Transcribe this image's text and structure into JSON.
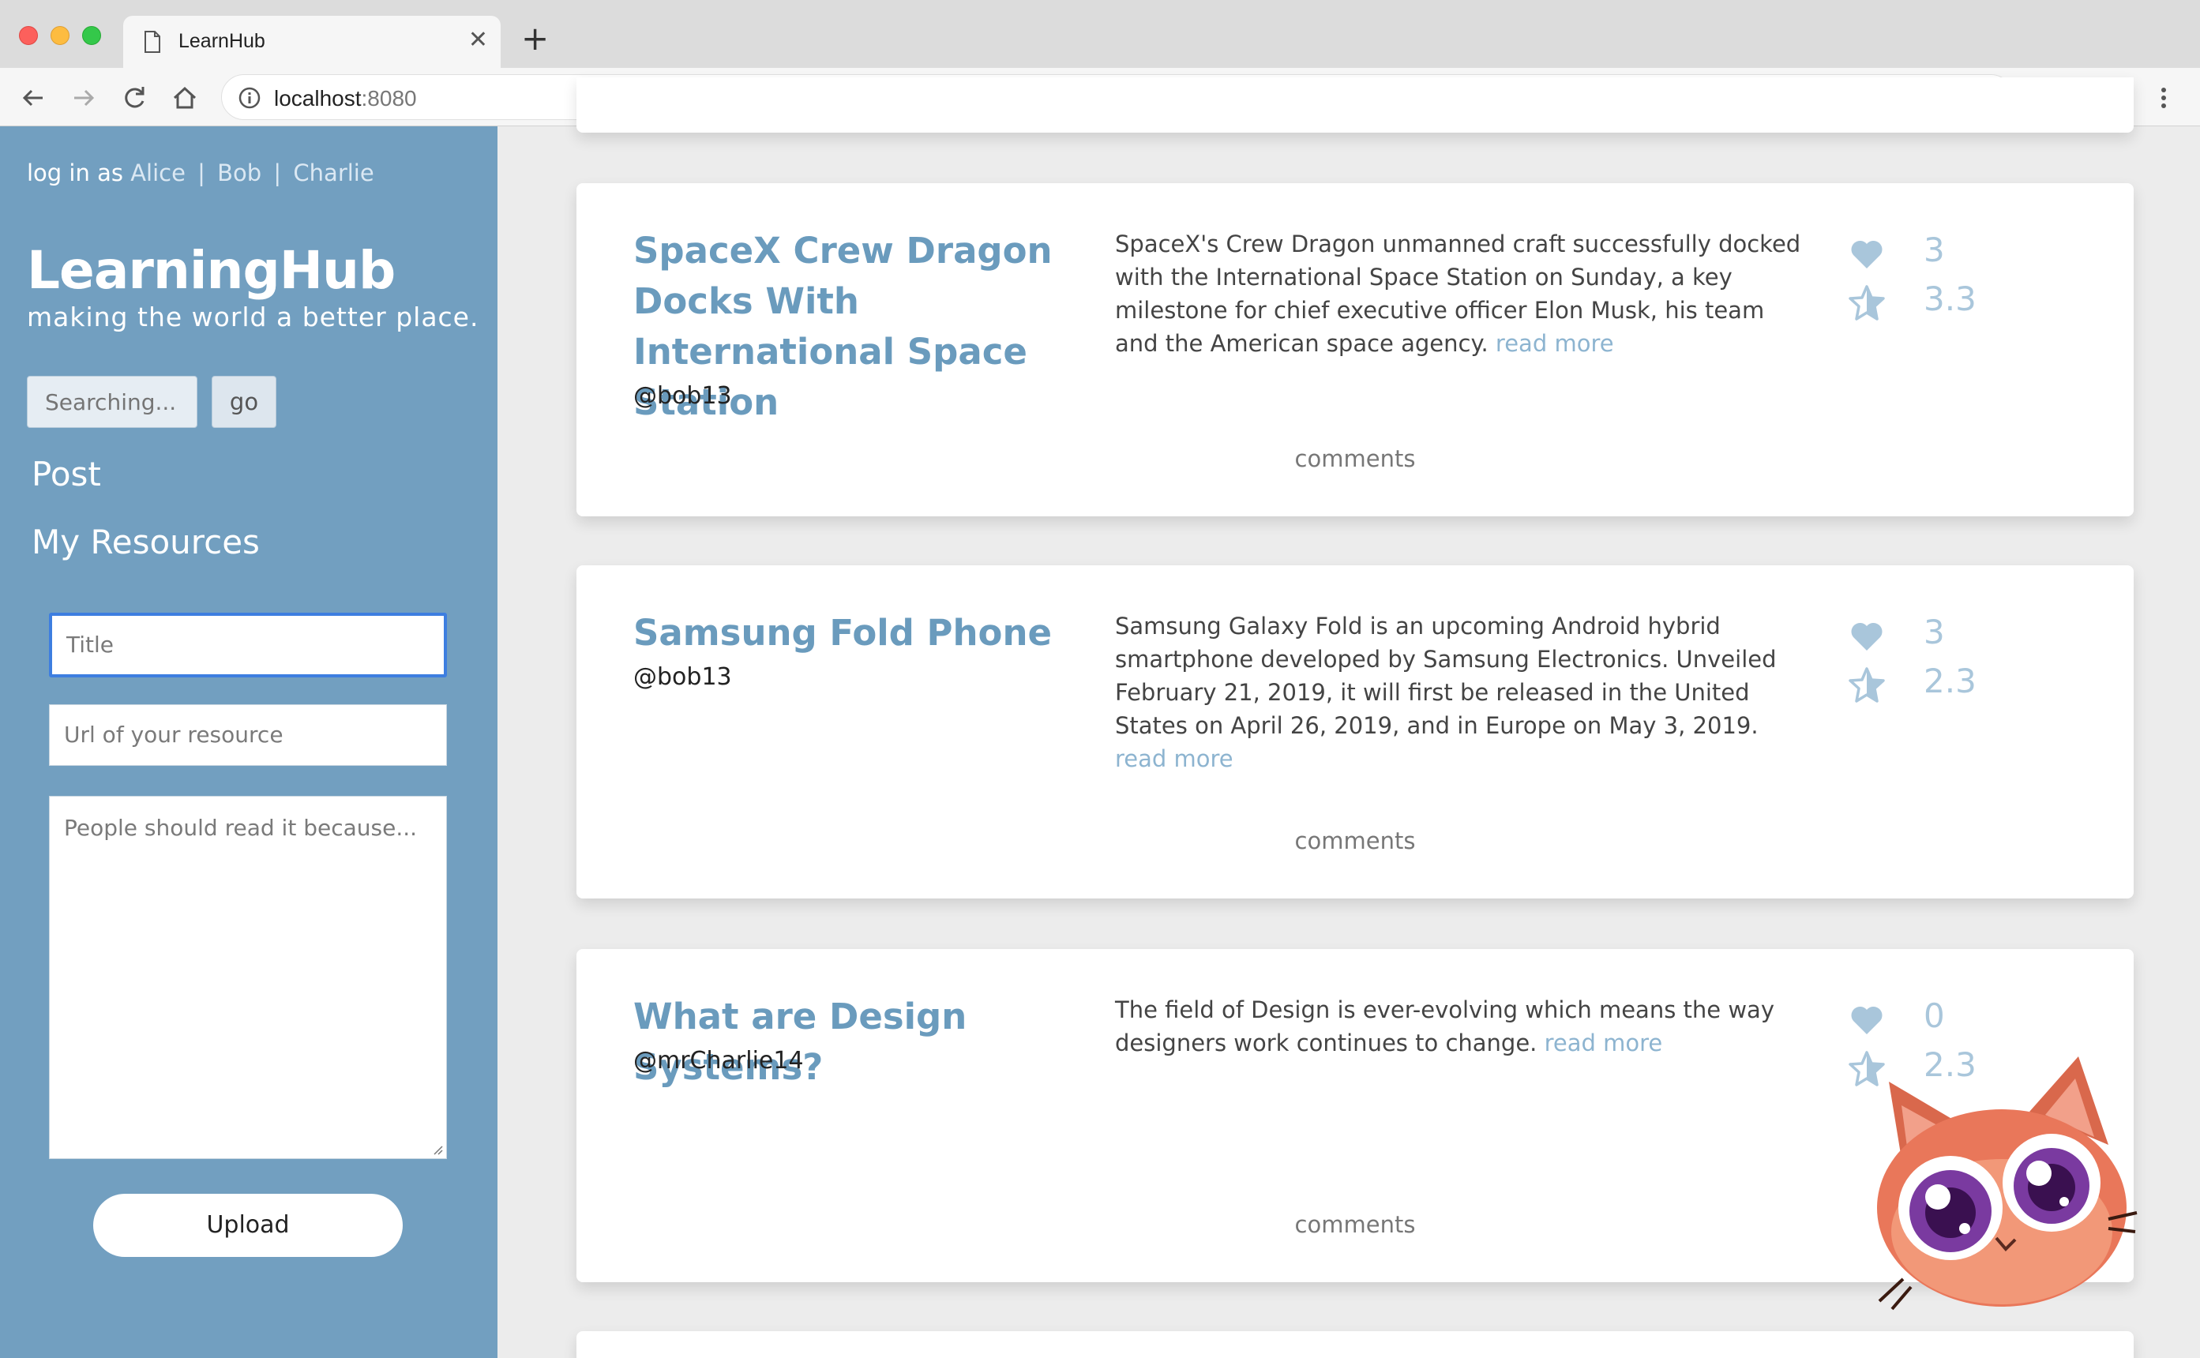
{
  "browser": {
    "tab_title": "LearnHub",
    "new_tab_symbol": "+",
    "close_symbol": "✕",
    "url_host": "localhost",
    "url_port": ":8080"
  },
  "sidebar": {
    "login_prefix": "log in as",
    "users": [
      "Alice",
      "Bob",
      "Charlie"
    ],
    "separator": "|",
    "brand": "LearningHub",
    "tagline": "making the world a better place.",
    "search_placeholder": "Searching...",
    "go_label": "go",
    "nav": [
      "Post",
      "My Resources"
    ],
    "form": {
      "title_placeholder": "Title",
      "url_placeholder": "Url of your resource",
      "reason_placeholder": "People should read it because...",
      "upload_label": "Upload"
    }
  },
  "resources": [
    {
      "title": "SpaceX Crew Dragon Docks With International Space Station",
      "author": "@bob13",
      "description": "SpaceX's Crew Dragon unmanned craft successfully docked with the International Space Station on Sunday, a key milestone for chief executive officer Elon Musk, his team and the American space agency.",
      "read_more": "read more",
      "likes": "3",
      "rating": "3.3",
      "comments_label": "comments"
    },
    {
      "title": "Samsung Fold Phone",
      "author": "@bob13",
      "description": "Samsung Galaxy Fold is an upcoming Android hybrid smartphone developed by Samsung Electronics. Unveiled February 21, 2019, it will first be released in the United States on April 26, 2019, and in Europe on May 3, 2019.",
      "read_more": "read more",
      "likes": "3",
      "rating": "2.3",
      "comments_label": "comments"
    },
    {
      "title": "What are Design Systems?",
      "author": "@mrCharlie14",
      "description": "The field of Design is ever-evolving which means the way designers work continues to change.",
      "read_more": "read more",
      "likes": "0",
      "rating": "2.3",
      "comments_label": "comments"
    }
  ],
  "colors": {
    "sidebar_bg": "#729fc0",
    "title_accent": "#6a9bbd",
    "stat_color": "#a9c6db",
    "focus_ring": "#3d7ee0"
  }
}
